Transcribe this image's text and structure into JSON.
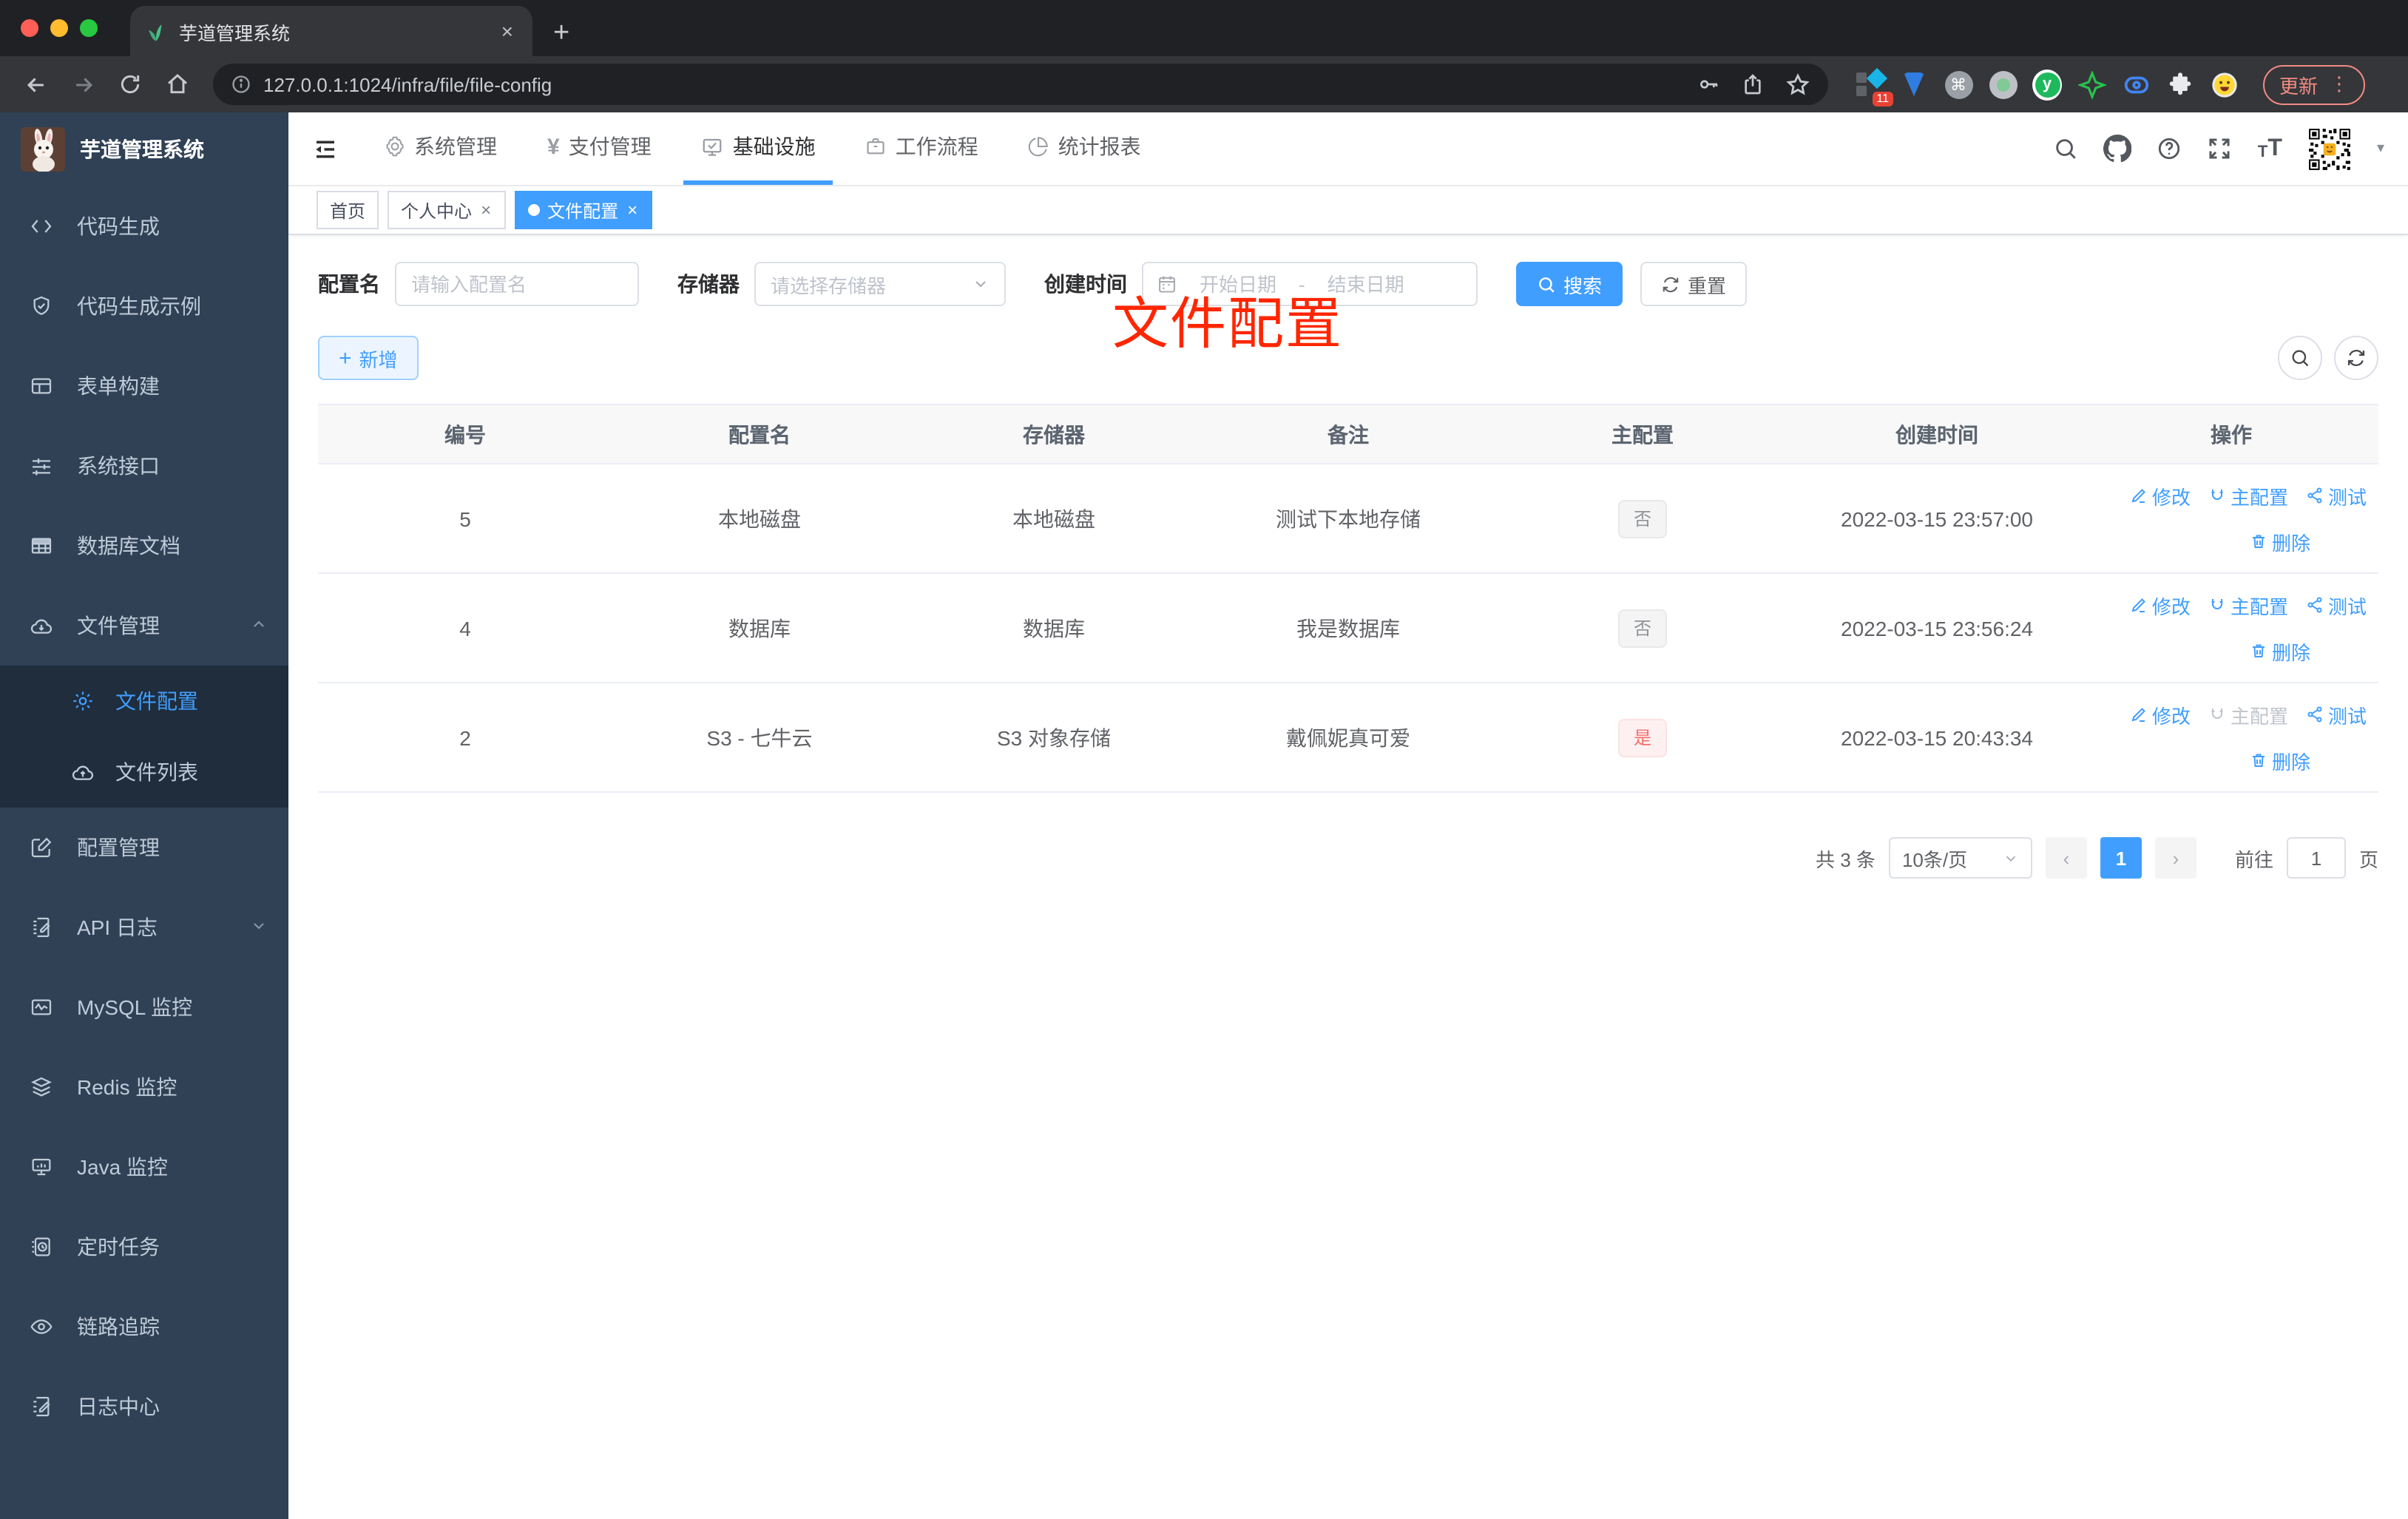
{
  "glyphs": {
    "close": "×",
    "plus": "+",
    "kebab": "⋮",
    "caret": "▾",
    "prev": "‹",
    "next": "›",
    "cmd": "⌘",
    "ext_y": "y",
    "font_small": "T",
    "font_large": "T"
  },
  "browser": {
    "tab_title": "芋道管理系统",
    "url": "127.0.0.1:1024/infra/file/file-config",
    "extension_badge": "11",
    "update_label": "更新"
  },
  "sidebar": {
    "title": "芋道管理系统",
    "items": [
      {
        "label": "代码生成"
      },
      {
        "label": "代码生成示例"
      },
      {
        "label": "表单构建"
      },
      {
        "label": "系统接口"
      },
      {
        "label": "数据库文档"
      },
      {
        "label": "文件管理"
      },
      {
        "label": "文件配置"
      },
      {
        "label": "文件列表"
      },
      {
        "label": "配置管理"
      },
      {
        "label": "API 日志"
      },
      {
        "label": "MySQL 监控"
      },
      {
        "label": "Redis 监控"
      },
      {
        "label": "Java 监控"
      },
      {
        "label": "定时任务"
      },
      {
        "label": "链路追踪"
      },
      {
        "label": "日志中心"
      }
    ]
  },
  "topnav": {
    "items": [
      {
        "label": "系统管理"
      },
      {
        "label": "支付管理"
      },
      {
        "label": "基础设施"
      },
      {
        "label": "工作流程"
      },
      {
        "label": "统计报表"
      }
    ]
  },
  "tags": [
    {
      "label": "首页"
    },
    {
      "label": "个人中心"
    },
    {
      "label": "文件配置"
    }
  ],
  "annotation": "文件配置",
  "filters": {
    "name_label": "配置名",
    "name_placeholder": "请输入配置名",
    "storage_label": "存储器",
    "storage_placeholder": "请选择存储器",
    "time_label": "创建时间",
    "start_placeholder": "开始日期",
    "range_separator": "-",
    "end_placeholder": "结束日期",
    "search_label": "搜索",
    "reset_label": "重置"
  },
  "toolbar": {
    "add_label": "新增"
  },
  "table": {
    "columns": [
      "编号",
      "配置名",
      "存储器",
      "备注",
      "主配置",
      "创建时间",
      "操作"
    ],
    "actions": {
      "modify": "修改",
      "master": "主配置",
      "test": "测试",
      "delete": "删除"
    },
    "rows": [
      {
        "id": "5",
        "name": "本地磁盘",
        "storage": "本地磁盘",
        "remark": "测试下本地存储",
        "master": "否",
        "created": "2022-03-15 23:57:00"
      },
      {
        "id": "4",
        "name": "数据库",
        "storage": "数据库",
        "remark": "我是数据库",
        "master": "否",
        "created": "2022-03-15 23:56:24"
      },
      {
        "id": "2",
        "name": "S3 - 七牛云",
        "storage": "S3 对象存储",
        "remark": "戴佩妮真可爱",
        "master": "是",
        "created": "2022-03-15 20:43:34"
      }
    ]
  },
  "pagination": {
    "total": "共 3 条",
    "page_size": "10条/页",
    "current_page": "1",
    "goto_label": "前往",
    "goto_value": "1",
    "page_unit": "页"
  },
  "colors": {
    "primary": "#409eff",
    "annotation_red": "#ff2600",
    "sidebar_bg": "#304156",
    "tag_danger_text": "#f56c6c"
  }
}
